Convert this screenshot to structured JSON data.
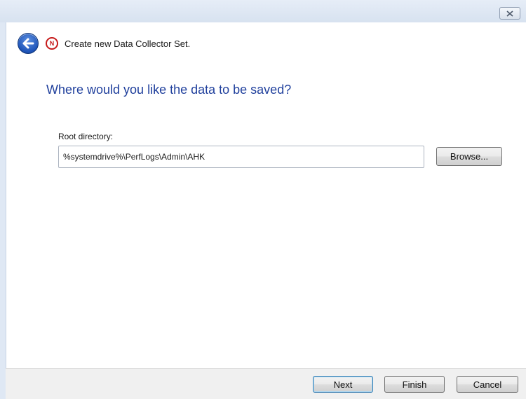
{
  "window": {
    "title": "Create new Data Collector Set."
  },
  "page": {
    "heading": "Where would you like the data to be saved?",
    "root_directory_label": "Root directory:",
    "root_directory_value": "%systemdrive%\\PerfLogs\\Admin\\AHK",
    "browse_label": "Browse..."
  },
  "footer": {
    "next_label": "Next",
    "finish_label": "Finish",
    "cancel_label": "Cancel"
  },
  "icons": {
    "back": "back-arrow-icon",
    "app": "performance-monitor-icon",
    "close": "close-icon"
  }
}
